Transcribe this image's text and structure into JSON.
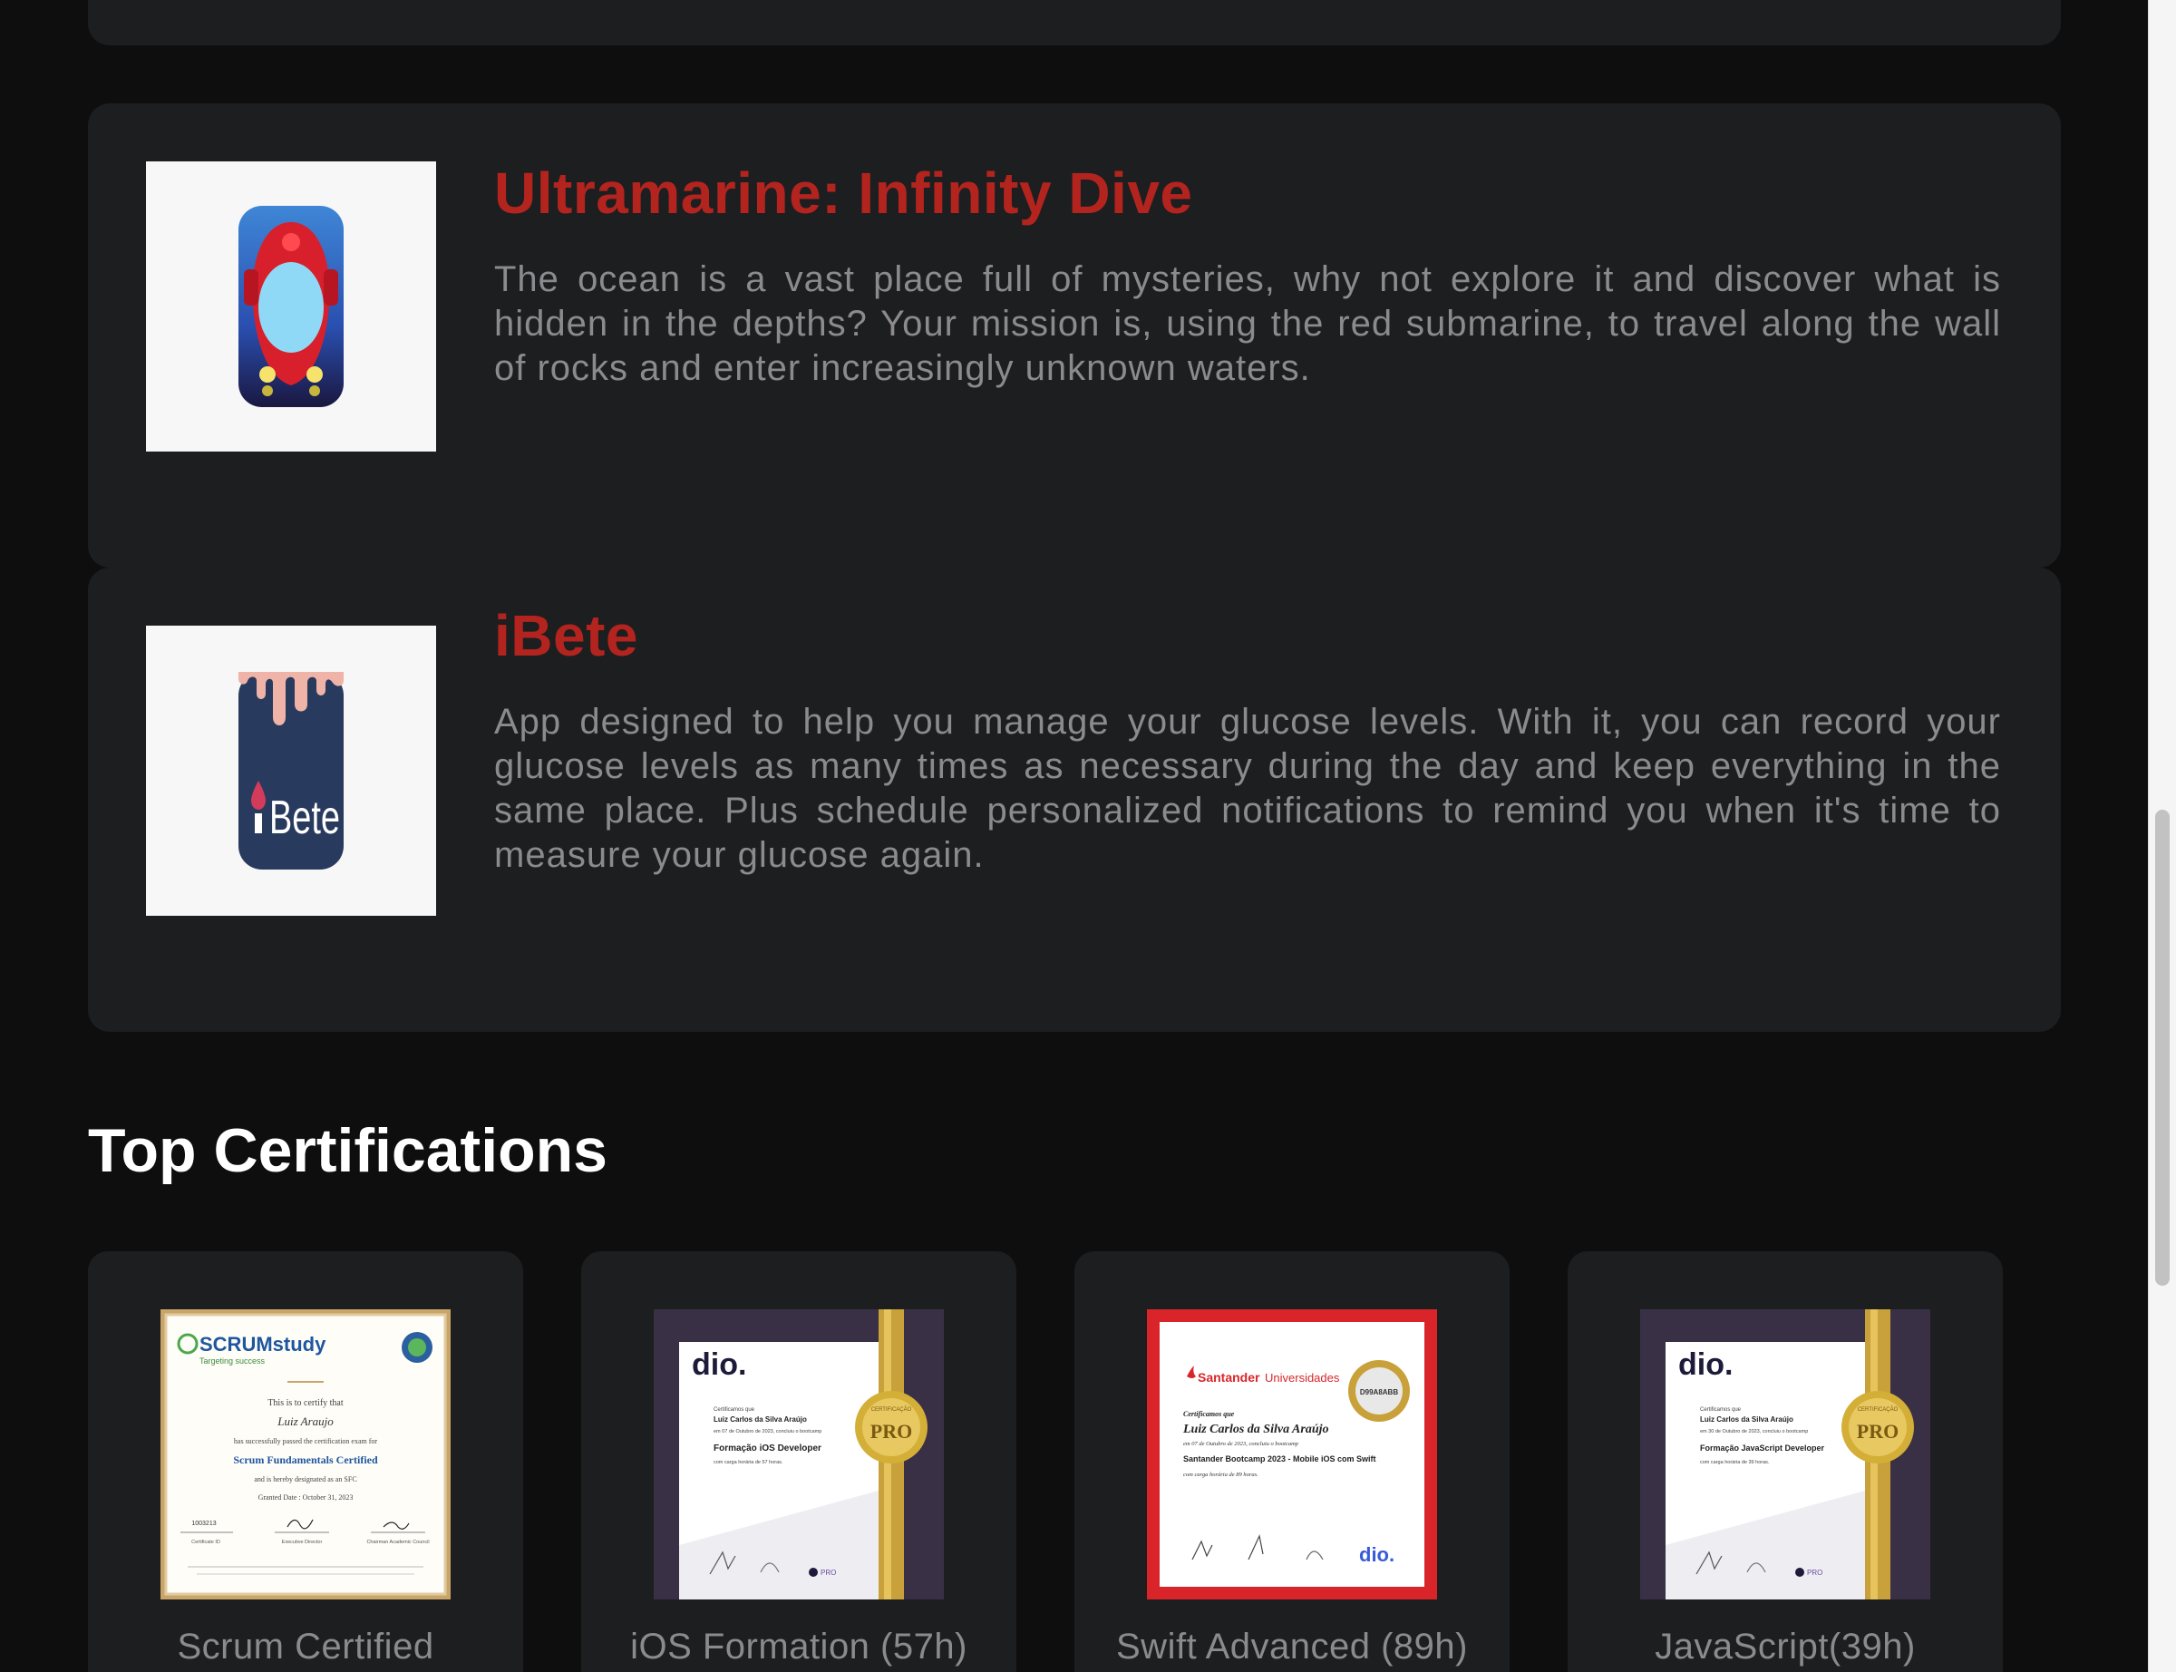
{
  "projects": [
    {
      "title": "Ultramarine: Infinity Dive",
      "description": "The ocean is a vast place full of mysteries, why not explore it and discover what is hidden in the depths? Your mission is, using the red submarine, to travel along the wall of rocks and enter increasingly unknown waters."
    },
    {
      "title": "iBete",
      "description": "App designed to help you manage your glucose levels. With it, you can record your glucose levels as many times as necessary during the day and keep everything in the same place. Plus schedule personalized notifications to remind you when it's time to measure your glucose again.",
      "icon_text": "Bete",
      "icon_prefix": "i"
    }
  ],
  "certifications": {
    "title": "Top Certifications",
    "items": [
      {
        "label": "Scrum Certified",
        "doc": {
          "brand": "SCRUMstudy",
          "tagline": "Targeting success",
          "certify": "This is to certify that",
          "name": "Luiz Araujo",
          "passed": "has successfully passed the certification exam for",
          "course": "Scrum Fundamentals Certified",
          "designated": "and is hereby designated as an SFC",
          "date": "Granted Date : October 31, 2023",
          "cert_id": "1003213",
          "sig1": "Certificate ID",
          "sig2": "Executive Director",
          "sig3": "Chairman Academic Council"
        }
      },
      {
        "label": "iOS Formation (57h)",
        "doc": {
          "brand": "dio.",
          "certify": "Certificamos que",
          "name": "Luiz Carlos da Silva Araújo",
          "line": "em 07 de Outubro de 2023, concluiu o bootcamp",
          "course": "Formação iOS Developer",
          "hours": "com carga horária de 57 horas.",
          "seal_top": "CERTIFICAÇÃO",
          "seal": "PRO",
          "pro": "PRO"
        }
      },
      {
        "label": "Swift Advanced (89h)",
        "doc": {
          "brand": "Santander",
          "brand2": "Universidades",
          "certify": "Certificamos que",
          "name": "Luiz Carlos da Silva Araújo",
          "line": "em 07 de Outubro de 2023, concluiu o bootcamp",
          "course": "Santander Bootcamp 2023 - Mobile iOS com Swift",
          "hours": "com carga horária de 89 horas.",
          "code": "D99A8ABB",
          "brand3": "dio."
        }
      },
      {
        "label": "JavaScript(39h)",
        "doc": {
          "brand": "dio.",
          "certify": "Certificamos que",
          "name": "Luiz Carlos da Silva Araújo",
          "line": "em 30 de Outubro de 2023, concluiu o bootcamp",
          "course": "Formação JavaScript Developer",
          "hours": "com carga horária de 39 horas.",
          "seal_top": "CERTIFICAÇÃO",
          "seal": "PRO",
          "pro": "PRO"
        }
      }
    ]
  },
  "colors": {
    "background": "#0e0e0f",
    "card": "#1d1e20",
    "accent": "#b3241f",
    "muted_text": "#8b8b8f"
  }
}
